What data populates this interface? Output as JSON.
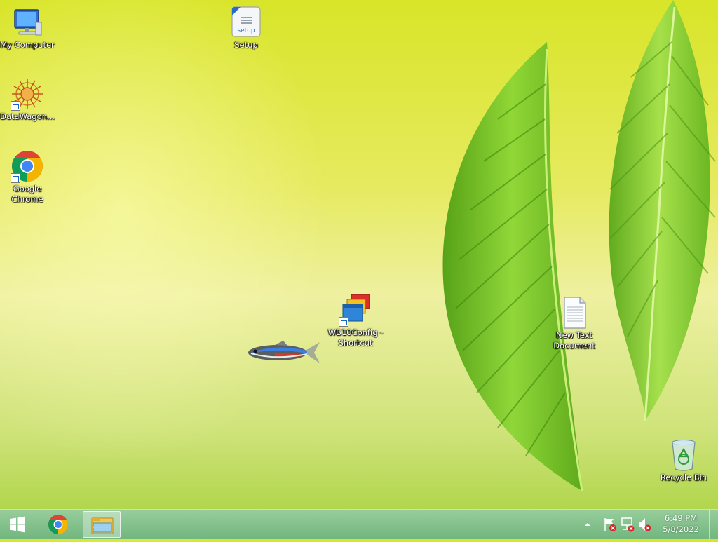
{
  "desktop": {
    "icons": [
      {
        "label": "My Computer"
      },
      {
        "label": "Setup",
        "badge": "setup"
      },
      {
        "label": "DataWagon..."
      },
      {
        "label": "Google Chrome"
      },
      {
        "label": "WB10Config - Shortcut"
      },
      {
        "label": "New Text Document"
      },
      {
        "label": "Recycle Bin"
      }
    ]
  },
  "taskbar": {
    "clock_time": "6:49 PM",
    "clock_date": "5/8/2022",
    "apps": [
      {
        "icon": "chrome-icon"
      },
      {
        "icon": "file-explorer-icon",
        "active": true
      }
    ],
    "tray_icons": [
      "show-hidden-icons-chevron",
      "action-center-flag-icon",
      "network-icon",
      "volume-muted-icon"
    ]
  },
  "colors": {
    "taskbar": "#7ebf8e",
    "wallpaper_top": "#d8e528",
    "wallpaper_bottom": "#a6d13c",
    "leaf": "#6cc21e"
  }
}
